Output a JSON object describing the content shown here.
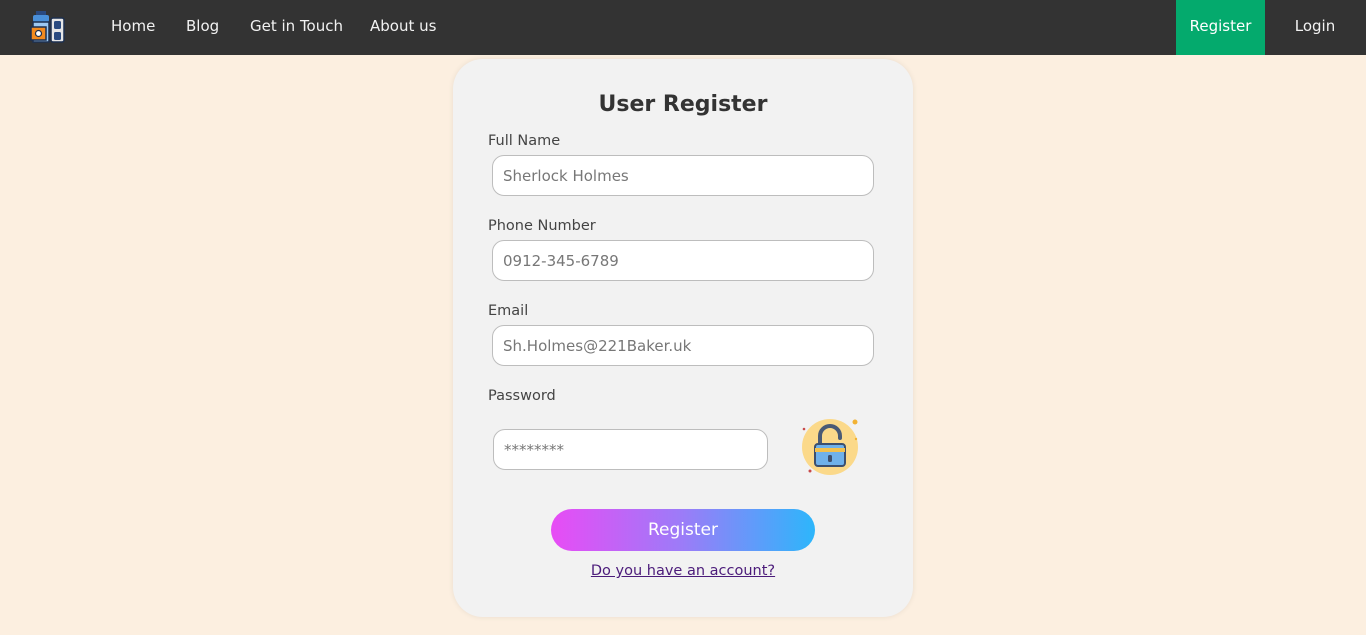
{
  "nav": {
    "links": [
      "Home",
      "Blog",
      "Get in Touch",
      "About us"
    ],
    "register_label": "Register",
    "login_label": "Login",
    "active_color": "#04aa6d"
  },
  "form": {
    "title": "User Register",
    "full_name": {
      "label": "Full Name",
      "placeholder": "Sherlock Holmes"
    },
    "phone": {
      "label": "Phone Number",
      "placeholder": "0912-345-6789"
    },
    "email": {
      "label": "Email",
      "placeholder": "Sh.Holmes@221Baker.uk"
    },
    "password": {
      "label": "Password",
      "placeholder": "********",
      "icon": "unlocked-padlock-icon"
    },
    "submit_label": "Register",
    "account_link": "Do you have an account?"
  },
  "colors": {
    "page_background": "#fcefe0",
    "navbar": "#333333",
    "card": "#f2f2f2",
    "button_gradient_start": "#e84cf5",
    "button_gradient_end": "#2db6fb"
  }
}
